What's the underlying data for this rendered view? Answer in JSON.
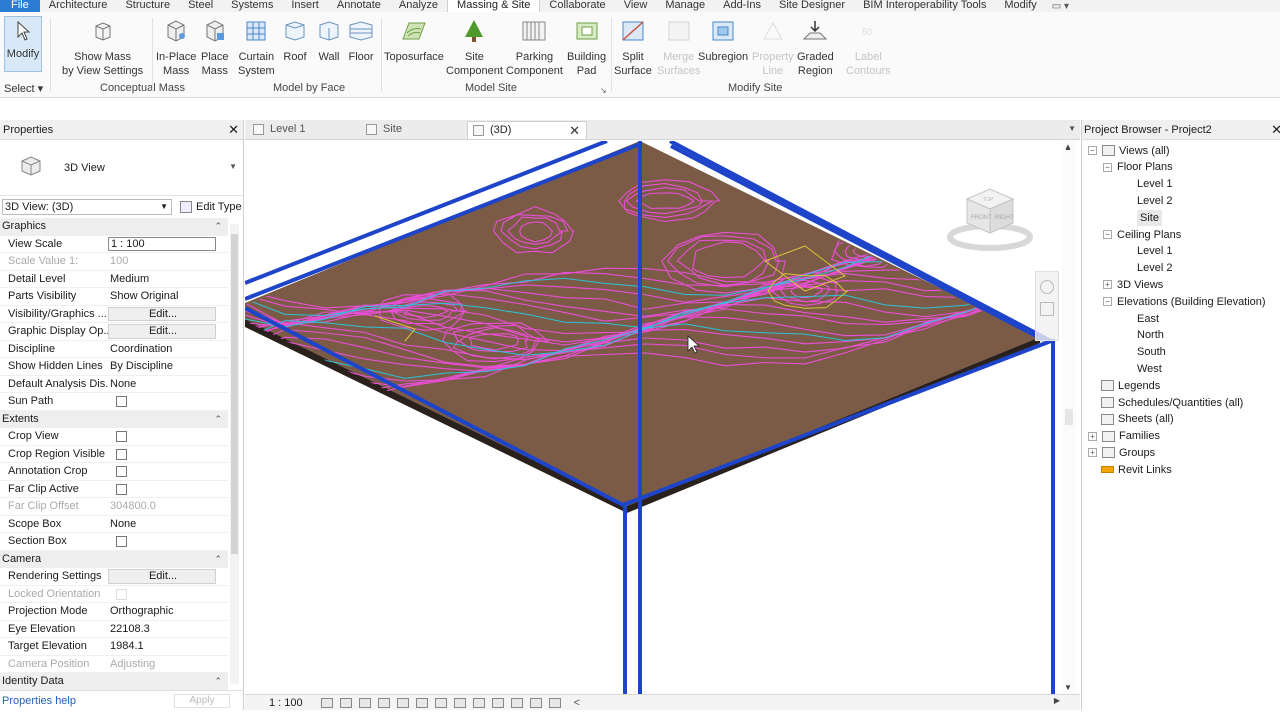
{
  "menu": {
    "tabs": [
      "File",
      "Architecture",
      "Structure",
      "Steel",
      "Systems",
      "Insert",
      "Annotate",
      "Analyze",
      "Massing & Site",
      "Collaborate",
      "View",
      "Manage",
      "Add-Ins",
      "Site Designer",
      "BIM Interoperability Tools",
      "Modify"
    ],
    "active_index": 8,
    "qat_glyph": "▭ ▾"
  },
  "ribbon": {
    "modify": "Modify",
    "select": "Select ▾",
    "show_mass": "Show Mass",
    "show_mass_2": "by View Settings",
    "in_place": "In-Place",
    "in_place_2": "Mass",
    "place": "Place",
    "place_2": "Mass",
    "curtain": "Curtain",
    "curtain_2": "System",
    "roof": "Roof",
    "wall": "Wall",
    "floor": "Floor",
    "toposurface": "Toposurface",
    "site": "Site",
    "site_2": "Component",
    "parking": "Parking",
    "parking_2": "Component",
    "building": "Building",
    "building_2": "Pad",
    "split": "Split",
    "split_2": "Surface",
    "merge": "Merge",
    "merge_2": "Surfaces",
    "subregion": "Subregion",
    "property": "Property",
    "property_2": "Line",
    "graded": "Graded",
    "graded_2": "Region",
    "label": "Label",
    "label_2": "Contours",
    "panel_conceptual": "Conceptual Mass",
    "panel_model_face": "Model by Face",
    "panel_model_site": "Model Site",
    "panel_modify_site": "Modify Site",
    "colors": {
      "accent": "#2b7cd3",
      "toposurface_icon": "#8bb85a",
      "site_tree": "#4e9a2c"
    }
  },
  "properties": {
    "title": "Properties",
    "type_name": "3D View",
    "view_selector": "3D View: (3D)",
    "edit_type": "Edit Type",
    "sections": {
      "graphics": "Graphics",
      "extents": "Extents",
      "camera": "Camera",
      "identity": "Identity Data"
    },
    "graphics_rows": [
      {
        "label": "View Scale",
        "value": "1 : 100"
      },
      {
        "label": "Scale Value    1:",
        "value": "100"
      },
      {
        "label": "Detail Level",
        "value": "Medium"
      },
      {
        "label": "Parts Visibility",
        "value": "Show Original"
      },
      {
        "label": "Visibility/Graphics ...",
        "value": "Edit..."
      },
      {
        "label": "Graphic Display Op...",
        "value": "Edit..."
      },
      {
        "label": "Discipline",
        "value": "Coordination"
      },
      {
        "label": "Show Hidden Lines",
        "value": "By Discipline"
      },
      {
        "label": "Default Analysis Dis...",
        "value": "None"
      },
      {
        "label": "Sun Path",
        "value": ""
      }
    ],
    "extents_rows": [
      {
        "label": "Crop View",
        "value": ""
      },
      {
        "label": "Crop Region Visible",
        "value": ""
      },
      {
        "label": "Annotation Crop",
        "value": ""
      },
      {
        "label": "Far Clip Active",
        "value": ""
      },
      {
        "label": "Far Clip Offset",
        "value": "304800.0"
      },
      {
        "label": "Scope Box",
        "value": "None"
      },
      {
        "label": "Section Box",
        "value": ""
      }
    ],
    "camera_rows": [
      {
        "label": "Rendering Settings",
        "value": "Edit..."
      },
      {
        "label": "Locked Orientation",
        "value": ""
      },
      {
        "label": "Projection Mode",
        "value": "Orthographic"
      },
      {
        "label": "Eye Elevation",
        "value": "22108.3"
      },
      {
        "label": "Target Elevation",
        "value": "1984.1"
      },
      {
        "label": "Camera Position",
        "value": "Adjusting"
      }
    ],
    "help": "Properties help",
    "apply": "Apply"
  },
  "view_tabs": [
    {
      "label": "Level 1",
      "active": false
    },
    {
      "label": "Site",
      "active": false
    },
    {
      "label": "(3D)",
      "active": true
    }
  ],
  "canvas": {
    "colors": {
      "terrain": "#7b5a46",
      "contour_pink": "#e94fd6",
      "contour_cyan": "#2cc2d6",
      "contour_yellow": "#d6c33a",
      "section_box": "#1d44c9"
    },
    "viewcube_faces": [
      "FRONT",
      "RIGHT",
      "TOP"
    ]
  },
  "status": {
    "scale": "1 : 100",
    "chevron": "<"
  },
  "browser": {
    "title": "Project Browser - Project2",
    "nodes": [
      {
        "label": "Views (all)",
        "depth": 0,
        "toggle": "−",
        "icon": true
      },
      {
        "label": "Floor Plans",
        "depth": 1,
        "toggle": "−"
      },
      {
        "label": "Level 1",
        "depth": 2
      },
      {
        "label": "Level 2",
        "depth": 2
      },
      {
        "label": "Site",
        "depth": 2,
        "selected": true
      },
      {
        "label": "Ceiling Plans",
        "depth": 1,
        "toggle": "−"
      },
      {
        "label": "Level 1",
        "depth": 2
      },
      {
        "label": "Level 2",
        "depth": 2
      },
      {
        "label": "3D Views",
        "depth": 1,
        "toggle": "+"
      },
      {
        "label": "Elevations (Building Elevation)",
        "depth": 1,
        "toggle": "−"
      },
      {
        "label": "East",
        "depth": 2
      },
      {
        "label": "North",
        "depth": 2
      },
      {
        "label": "South",
        "depth": 2
      },
      {
        "label": "West",
        "depth": 2
      },
      {
        "label": "Legends",
        "depth": 0,
        "icon": true
      },
      {
        "label": "Schedules/Quantities (all)",
        "depth": 0,
        "icon": true
      },
      {
        "label": "Sheets (all)",
        "depth": 0,
        "icon": true
      },
      {
        "label": "Families",
        "depth": 0,
        "toggle": "+",
        "icon": true
      },
      {
        "label": "Groups",
        "depth": 0,
        "toggle": "+",
        "icon": true
      },
      {
        "label": "Revit Links",
        "depth": 0,
        "icon": "link"
      }
    ]
  }
}
